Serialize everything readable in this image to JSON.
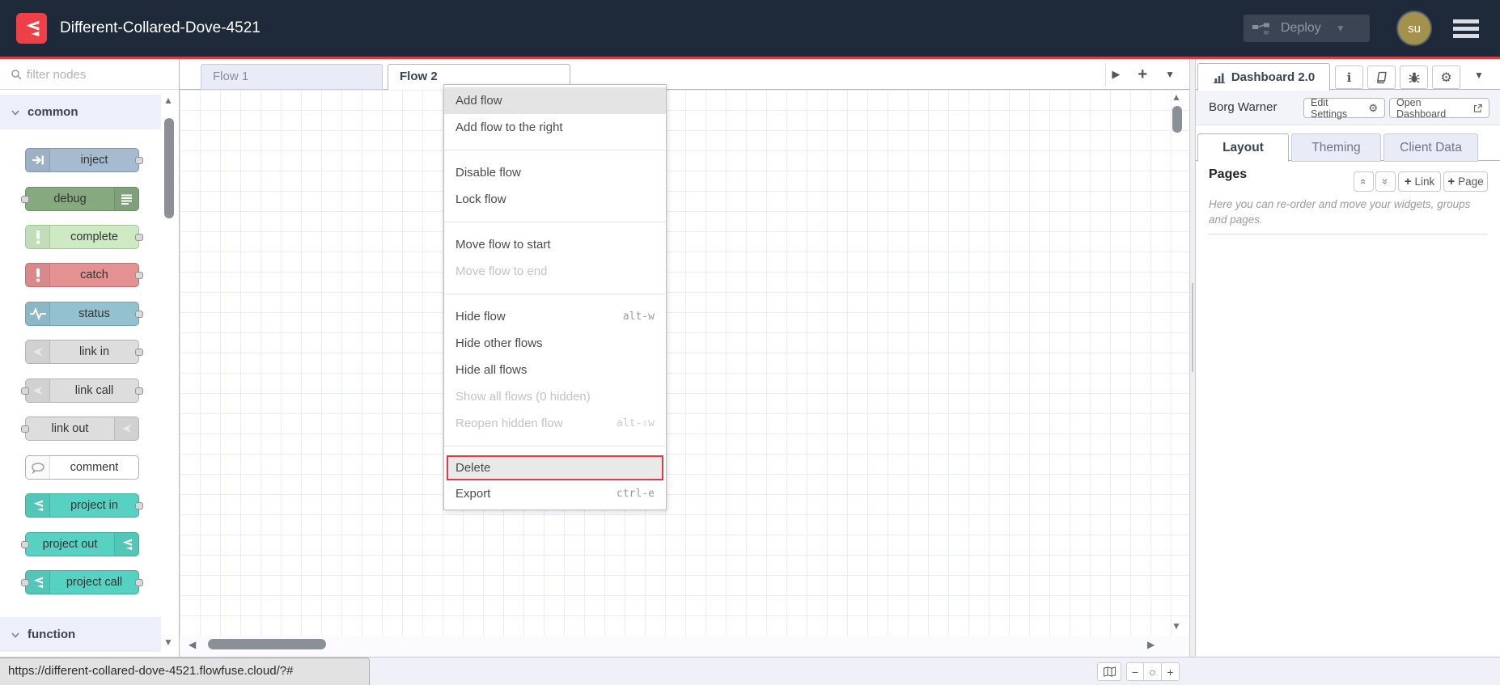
{
  "header": {
    "title": "Different-Collared-Dove-4521",
    "deploy_label": "Deploy",
    "avatar_initials": "su"
  },
  "palette": {
    "filter_placeholder": "filter nodes",
    "sections": [
      {
        "label": "common"
      },
      {
        "label": "function"
      }
    ],
    "nodes": [
      {
        "label": "inject",
        "color": "#a6bbcf",
        "border": "#8296ac",
        "icon": "arrow-in-icon",
        "icon_side": "left",
        "ports": [
          "right"
        ]
      },
      {
        "label": "debug",
        "color": "#87a980",
        "border": "#6d8f66",
        "icon": "debug-list-icon",
        "icon_side": "right",
        "ports": [
          "left"
        ]
      },
      {
        "label": "complete",
        "color": "#cdeac2",
        "border": "#a0c795",
        "icon": "exclamation-icon",
        "icon_side": "left",
        "ports": [
          "right"
        ]
      },
      {
        "label": "catch",
        "color": "#e49191",
        "border": "#c76f6f",
        "icon": "exclamation-icon",
        "icon_side": "left",
        "ports": [
          "right"
        ]
      },
      {
        "label": "status",
        "color": "#94c1d0",
        "border": "#71a3b5",
        "icon": "pulse-icon",
        "icon_side": "left",
        "ports": [
          "right"
        ]
      },
      {
        "label": "link in",
        "color": "#dddddd",
        "border": "#b3b3b3",
        "icon": "link-icon",
        "icon_side": "left",
        "ports": [
          "right"
        ],
        "icon_faded": true
      },
      {
        "label": "link call",
        "color": "#dddddd",
        "border": "#b3b3b3",
        "icon": "link-icon",
        "icon_side": "left",
        "ports": [
          "left",
          "right"
        ],
        "icon_faded": true
      },
      {
        "label": "link out",
        "color": "#dddddd",
        "border": "#b3b3b3",
        "icon": "link-icon",
        "icon_side": "right",
        "ports": [
          "left"
        ],
        "icon_faded": true
      },
      {
        "label": "comment",
        "color": "#ffffff",
        "border": "#b0b0b0",
        "icon": "comment-icon",
        "icon_side": "left",
        "ports": []
      },
      {
        "label": "project in",
        "color": "#57d1c1",
        "border": "#3fae9f",
        "icon": "flowfuse-icon",
        "icon_side": "left",
        "ports": [
          "right"
        ]
      },
      {
        "label": "project out",
        "color": "#57d1c1",
        "border": "#3fae9f",
        "icon": "flowfuse-icon",
        "icon_side": "right",
        "ports": [
          "left"
        ]
      },
      {
        "label": "project call",
        "color": "#57d1c1",
        "border": "#3fae9f",
        "icon": "flowfuse-icon",
        "icon_side": "left",
        "ports": [
          "left",
          "right"
        ]
      }
    ]
  },
  "tabs": {
    "flow1": "Flow 1",
    "flow2": "Flow 2"
  },
  "context_menu": {
    "items": [
      {
        "label": "Add flow",
        "state": "hover"
      },
      {
        "label": "Add flow to the right"
      },
      {
        "type": "separator"
      },
      {
        "label": "Disable flow"
      },
      {
        "label": "Lock flow"
      },
      {
        "type": "separator"
      },
      {
        "label": "Move flow to start"
      },
      {
        "label": "Move flow to end",
        "state": "disabled"
      },
      {
        "type": "separator"
      },
      {
        "label": "Hide flow",
        "shortcut": "alt-w"
      },
      {
        "label": "Hide other flows"
      },
      {
        "label": "Hide all flows"
      },
      {
        "label": "Show all flows (0 hidden)",
        "state": "disabled"
      },
      {
        "label": "Reopen hidden flow",
        "shortcut": "alt-⇧w",
        "state": "disabled"
      },
      {
        "type": "separator"
      },
      {
        "label": "Delete",
        "state": "selected"
      },
      {
        "label": "Export",
        "shortcut": "ctrl-e"
      }
    ]
  },
  "sidebar": {
    "tab_label": "Dashboard 2.0",
    "project_name": "Borg Warner",
    "edit_settings_label": "Edit Settings",
    "open_dashboard_label": "Open Dashboard",
    "tabs": [
      {
        "label": "Layout"
      },
      {
        "label": "Theming"
      },
      {
        "label": "Client Data"
      }
    ],
    "pages_title": "Pages",
    "add_link_label": "Link",
    "add_page_label": "Page",
    "help_text": "Here you can re-order and move your widgets, groups and pages."
  },
  "status_bar": {
    "url": "https://different-collared-dove-4521.flowfuse.cloud/?#"
  },
  "colors": {
    "accent_red": "#dd3b44",
    "header_bg": "#1e2a3a",
    "project_teal": "#57d1c1"
  }
}
